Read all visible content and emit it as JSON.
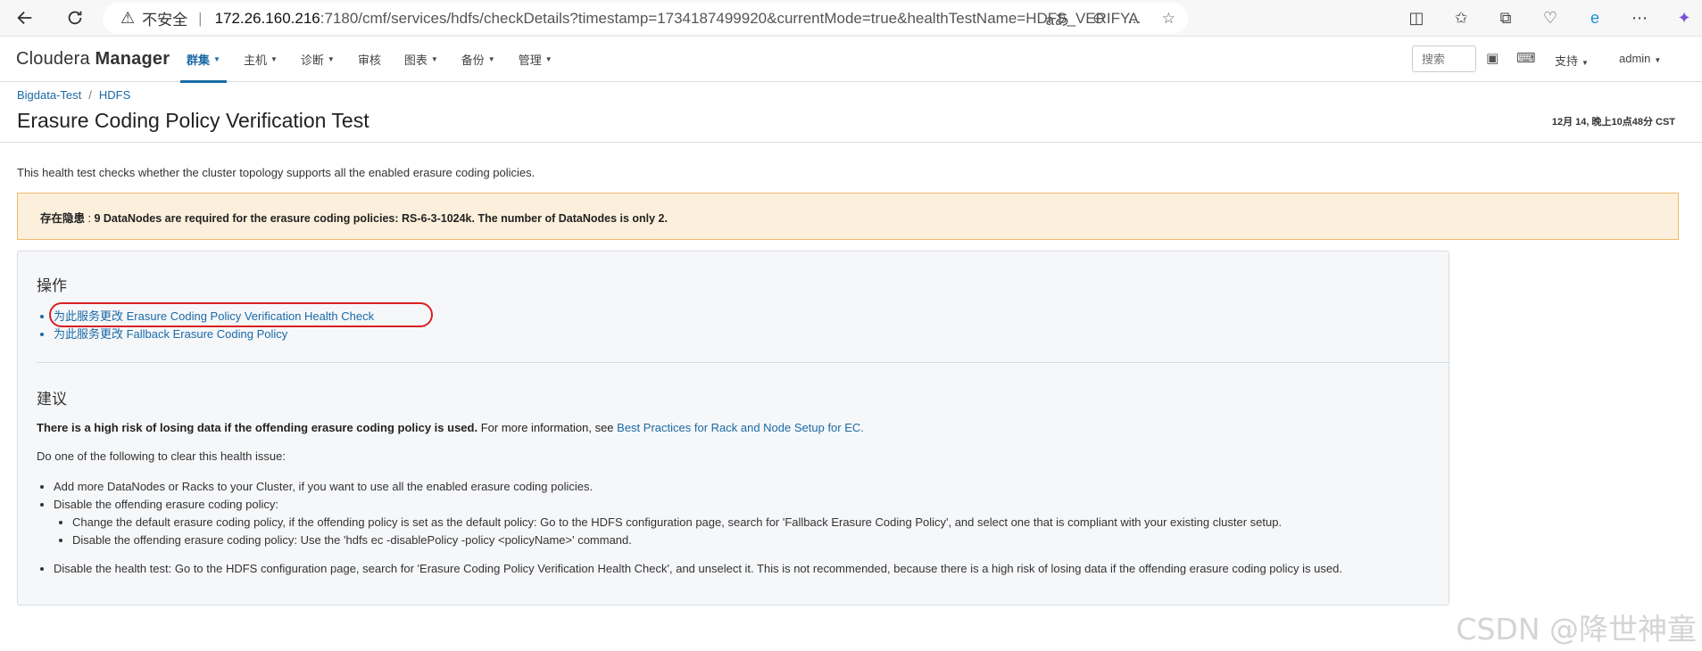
{
  "browser": {
    "insecure_label": "不安全",
    "url_host": "172.26.160.216",
    "url_path": ":7180/cmf/services/hdfs/checkDetails?timestamp=1734187499920&currentMode=true&healthTestName=HDFS_VERIFY..."
  },
  "header": {
    "brand_light": "Cloudera ",
    "brand_bold": "Manager",
    "menu": [
      {
        "label": "群集",
        "dropdown": true,
        "active": true
      },
      {
        "label": "主机",
        "dropdown": true
      },
      {
        "label": "诊断",
        "dropdown": true
      },
      {
        "label": "审核",
        "dropdown": false
      },
      {
        "label": "图表",
        "dropdown": true
      },
      {
        "label": "备份",
        "dropdown": true
      },
      {
        "label": "管理",
        "dropdown": true
      }
    ],
    "search_placeholder": "搜索",
    "support_label": "支持",
    "user_label": "admin"
  },
  "breadcrumb": {
    "cluster": "Bigdata-Test",
    "service": "HDFS"
  },
  "page": {
    "title": "Erasure Coding Policy Verification Test",
    "timestamp": "12月 14, 晚上10点48分 CST",
    "description": "This health test checks whether the cluster topology supports all the enabled erasure coding policies."
  },
  "alert": {
    "level": "存在隐患",
    "message": "9 DataNodes are required for the erasure coding policies: RS-6-3-1024k. The number of DataNodes is only 2."
  },
  "actions": {
    "heading": "操作",
    "items": [
      "为此服务更改 Erasure Coding Policy Verification Health Check",
      "为此服务更改 Fallback Erasure Coding Policy"
    ]
  },
  "advice": {
    "heading": "建议",
    "strong": "There is a high risk of losing data if the offending erasure coding policy is used.",
    "more_info": " For more information, see ",
    "link": "Best Practices for Rack and Node Setup for EC.",
    "do_one": "Do one of the following to clear this health issue:",
    "item1": "Add more DataNodes or Racks to your Cluster, if you want to use all the enabled erasure coding policies.",
    "item2": "Disable the offending erasure coding policy:",
    "item2_sub1": "Change the default erasure coding policy, if the offending policy is set as the default policy: Go to the HDFS configuration page, search for 'Fallback Erasure Coding Policy', and select one that is compliant with your existing cluster setup.",
    "item2_sub2": "Disable the offending erasure coding policy: Use the 'hdfs ec -disablePolicy -policy <policyName>' command.",
    "item3": "Disable the health test: Go to the HDFS configuration page, search for 'Erasure Coding Policy Verification Health Check', and unselect it. This is not recommended, because there is a high risk of losing data if the offending erasure coding policy is used."
  },
  "watermark": "CSDN @降世神童"
}
